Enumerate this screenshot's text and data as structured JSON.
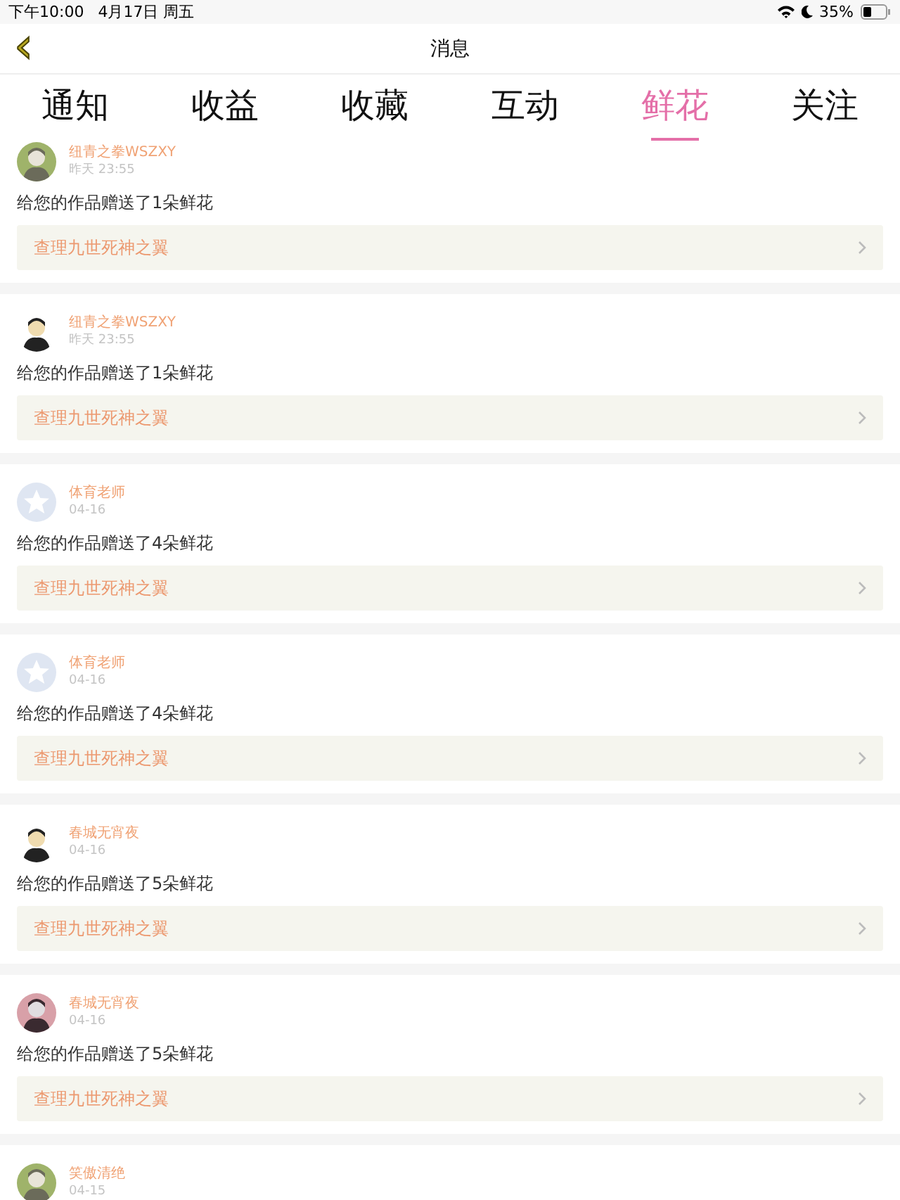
{
  "status_bar": {
    "time": "下午10:00",
    "date": "4月17日 周五",
    "battery": "35%"
  },
  "nav": {
    "back": "‹",
    "title": "消息"
  },
  "tabs": [
    {
      "label": "通知",
      "selected": false
    },
    {
      "label": "收益",
      "selected": false
    },
    {
      "label": "收藏",
      "selected": false
    },
    {
      "label": "互动",
      "selected": false
    },
    {
      "label": "鲜花",
      "selected": true
    },
    {
      "label": "关注",
      "selected": false
    }
  ],
  "messages": [
    {
      "user": "纽青之拳WSZXY",
      "time": "昨天 23:55",
      "text": "给您的作品赠送了1朵鲜花",
      "link": "查理九世死神之翼"
    },
    {
      "user": "纽青之拳WSZXY",
      "time": "昨天 23:55",
      "text": "给您的作品赠送了1朵鲜花",
      "link": "查理九世死神之翼"
    },
    {
      "user": "体育老师",
      "time": "04-16",
      "avatar": {
        "kind": "default"
      },
      "text": "给您的作品赠送了4朵鲜花",
      "link": "查理九世死神之翼"
    },
    {
      "user": "体育老师",
      "time": "04-16",
      "avatar": {
        "kind": "default"
      },
      "text": "给您的作品赠送了4朵鲜花",
      "link": "查理九世死神之翼"
    },
    {
      "user": "春城无宵夜",
      "time": "04-16",
      "text": "给您的作品赠送了5朵鲜花",
      "link": "查理九世死神之翼"
    },
    {
      "user": "春城无宵夜",
      "time": "04-16",
      "text": "给您的作品赠送了5朵鲜花",
      "link": "查理九世死神之翼"
    },
    {
      "user": "笑傲清绝",
      "time": "04-15"
    }
  ]
}
